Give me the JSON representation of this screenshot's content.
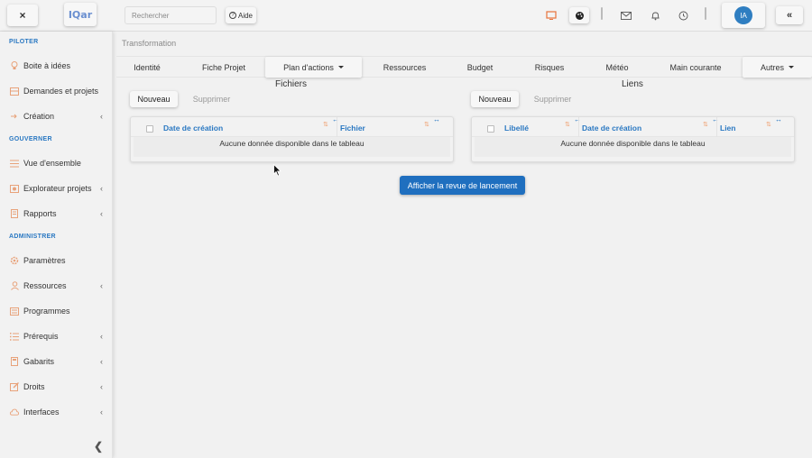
{
  "topbar": {
    "close_label": "×",
    "logo_text": "IQar",
    "search_placeholder": "Rechercher",
    "help_label": "Aide",
    "user_initials": "IA",
    "collapse_label": "«"
  },
  "sidebar": {
    "sections": [
      {
        "title": "PILOTER",
        "items": [
          {
            "label": "Boite à idées",
            "icon": "lightbulb-icon",
            "chevron": false
          },
          {
            "label": "Demandes et projets",
            "icon": "inbox-icon",
            "chevron": false
          },
          {
            "label": "Création",
            "icon": "arrow-icon",
            "chevron": true
          }
        ]
      },
      {
        "title": "GOUVERNER",
        "items": [
          {
            "label": "Vue d'ensemble",
            "icon": "list-icon",
            "chevron": false
          },
          {
            "label": "Explorateur projets",
            "icon": "explorer-icon",
            "chevron": true
          },
          {
            "label": "Rapports",
            "icon": "report-icon",
            "chevron": true
          }
        ]
      },
      {
        "title": "ADMINISTRER",
        "items": [
          {
            "label": "Paramètres",
            "icon": "gear-icon",
            "chevron": false
          },
          {
            "label": "Ressources",
            "icon": "user-icon",
            "chevron": true
          },
          {
            "label": "Programmes",
            "icon": "program-icon",
            "chevron": false
          },
          {
            "label": "Prérequis",
            "icon": "checklist-icon",
            "chevron": true
          },
          {
            "label": "Gabarits",
            "icon": "template-icon",
            "chevron": true
          },
          {
            "label": "Droits",
            "icon": "edit-icon",
            "chevron": true
          },
          {
            "label": "Interfaces",
            "icon": "cloud-icon",
            "chevron": true
          }
        ]
      }
    ],
    "collapse_label": "❮"
  },
  "main": {
    "breadcrumb": "Transformation",
    "tabs": [
      "Identité",
      "Fiche Projet",
      "Plan d'actions",
      "Ressources",
      "Budget",
      "Risques",
      "Météo",
      "Main courante",
      "Autres"
    ],
    "files": {
      "title": "Fichiers",
      "new_label": "Nouveau",
      "delete_label": "Supprimer",
      "columns": [
        "Date de création",
        "Fichier"
      ],
      "empty_text": "Aucune donnée disponible dans le tableau"
    },
    "links": {
      "title": "Liens",
      "new_label": "Nouveau",
      "delete_label": "Supprimer",
      "columns": [
        "Libellé",
        "Date de création",
        "Lien"
      ],
      "empty_text": "Aucune donnée disponible dans le tableau"
    },
    "launch_button": "Afficher la revue de lancement"
  },
  "colors": {
    "accent": "#2a78c2",
    "primary_button": "#1f6fbf",
    "avatar": "#2f7ec1",
    "sidebar_icon": "#e8a27a"
  }
}
